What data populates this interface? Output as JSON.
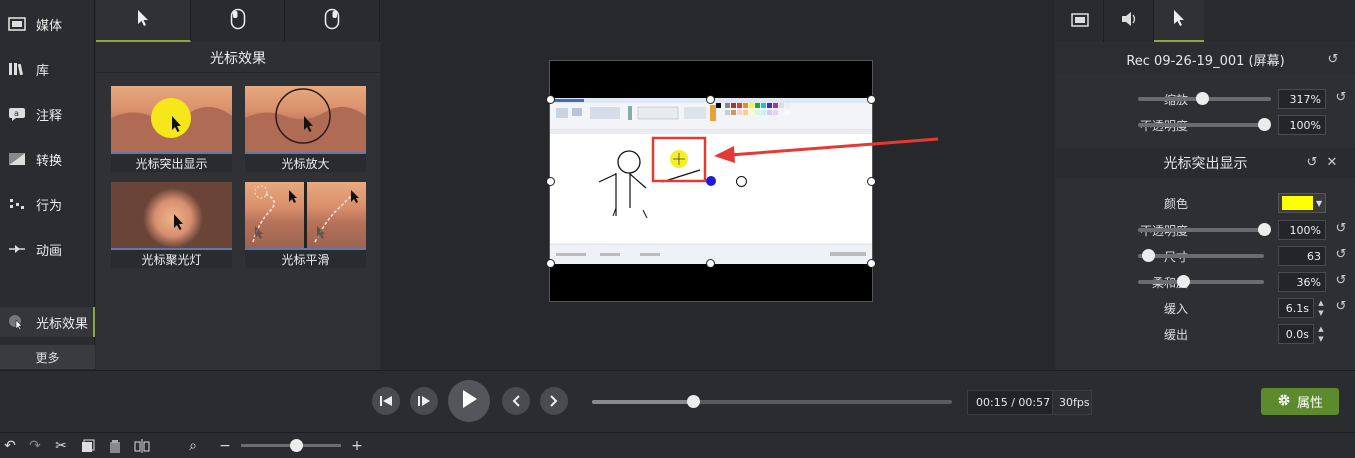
{
  "rail": {
    "items": [
      {
        "label": "媒体"
      },
      {
        "label": "库"
      },
      {
        "label": "注释"
      },
      {
        "label": "转换"
      },
      {
        "label": "行为"
      },
      {
        "label": "动画"
      },
      {
        "label": "光标效果"
      }
    ],
    "more_label": "更多"
  },
  "effects": {
    "title": "光标效果",
    "items": [
      {
        "label": "光标突出显示"
      },
      {
        "label": "光标放大"
      },
      {
        "label": "光标聚光灯"
      },
      {
        "label": "光标平滑"
      }
    ]
  },
  "properties": {
    "media_title": "Rec 09-26-19_001 (屏幕)",
    "scale": {
      "label": "缩放",
      "value": "317%",
      "level": 0.48
    },
    "opacity": {
      "label": "不透明度",
      "value": "100%",
      "level": 1.0
    },
    "effect_title": "光标突出显示",
    "color": {
      "label": "颜色",
      "hex": "#ffff00"
    },
    "fx_opacity": {
      "label": "不透明度",
      "value": "100%",
      "level": 1.0
    },
    "size": {
      "label": "尺寸",
      "value": "63",
      "level": 0.08
    },
    "softness": {
      "label": "柔和度",
      "value": "36%",
      "level": 0.36
    },
    "ease_in": {
      "label": "缓入",
      "value": "6.1s"
    },
    "ease_out": {
      "label": "缓出",
      "value": "0.0s"
    }
  },
  "transport": {
    "time": "00:15 / 00:57",
    "fps": "30fps",
    "progress": 0.28,
    "properties_label": "属性"
  },
  "zoom": {
    "level": 0.55
  },
  "colors": {
    "accent": "#8aa83b",
    "button_green": "#5d8a2c",
    "highlight_red": "#e53935"
  }
}
